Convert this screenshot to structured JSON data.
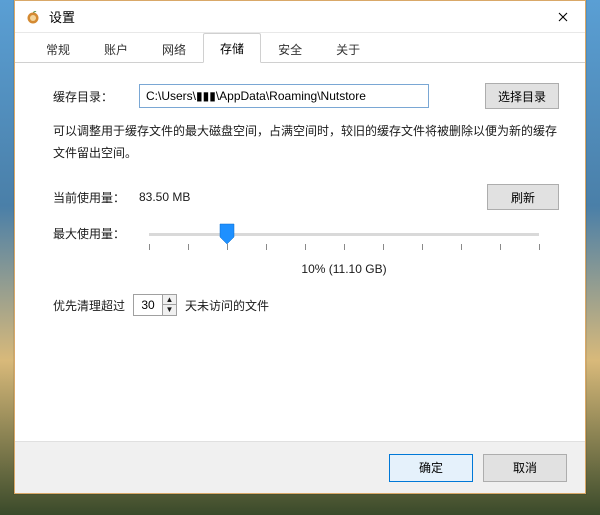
{
  "window": {
    "title": "设置",
    "icon_name": "nutstore-icon"
  },
  "tabs": {
    "items": [
      {
        "label": "常规"
      },
      {
        "label": "账户"
      },
      {
        "label": "网络"
      },
      {
        "label": "存储",
        "active": true
      },
      {
        "label": "安全"
      },
      {
        "label": "关于"
      }
    ]
  },
  "storage": {
    "cache_dir_label": "缓存目录：",
    "cache_dir_value": "C:\\Users\\▮▮▮\\AppData\\Roaming\\Nutstore",
    "choose_dir_btn": "选择目录",
    "description": "可以调整用于缓存文件的最大磁盘空间，占满空间时，较旧的缓存文件将被删除以便为新的缓存文件留出空间。",
    "current_usage_label": "当前使用量：",
    "current_usage_value": "83.50 MB",
    "refresh_btn": "刷新",
    "max_usage_label": "最大使用量：",
    "slider": {
      "percent": 10,
      "caption": "10% (11.10 GB)"
    },
    "cleanup_prefix": "优先清理超过",
    "cleanup_days": "30",
    "cleanup_suffix": "天未访问的文件"
  },
  "footer": {
    "ok": "确定",
    "cancel": "取消"
  },
  "colors": {
    "accent": "#0078d7"
  }
}
